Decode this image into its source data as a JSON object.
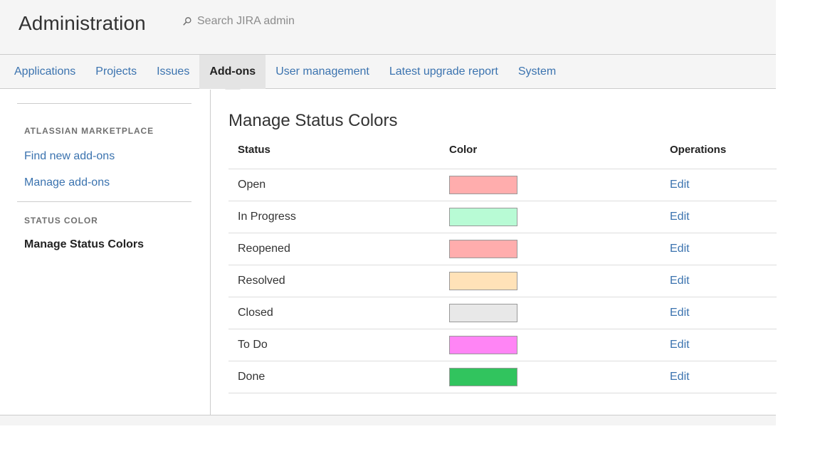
{
  "header": {
    "title": "Administration",
    "search_placeholder": "Search JIRA admin",
    "search_icon": "search-icon"
  },
  "tabs": [
    {
      "label": "Applications",
      "active": false
    },
    {
      "label": "Projects",
      "active": false
    },
    {
      "label": "Issues",
      "active": false
    },
    {
      "label": "Add-ons",
      "active": true
    },
    {
      "label": "User management",
      "active": false
    },
    {
      "label": "Latest upgrade report",
      "active": false
    },
    {
      "label": "System",
      "active": false
    }
  ],
  "sidebar": {
    "sections": [
      {
        "heading": "ATLASSIAN MARKETPLACE",
        "items": [
          {
            "label": "Find new add-ons",
            "current": false
          },
          {
            "label": "Manage add-ons",
            "current": false
          }
        ]
      },
      {
        "heading": "STATUS COLOR",
        "items": [
          {
            "label": "Manage Status Colors",
            "current": true
          }
        ]
      }
    ]
  },
  "main": {
    "page_title": "Manage Status Colors",
    "table": {
      "columns": [
        "Status",
        "Color",
        "Operations"
      ],
      "rows": [
        {
          "status": "Open",
          "color": "#ffadad",
          "edit_label": "Edit"
        },
        {
          "status": "In Progress",
          "color": "#b8fbd5",
          "edit_label": "Edit"
        },
        {
          "status": "Reopened",
          "color": "#ffadad",
          "edit_label": "Edit"
        },
        {
          "status": "Resolved",
          "color": "#ffe2b8",
          "edit_label": "Edit"
        },
        {
          "status": "Closed",
          "color": "#e8e8e8",
          "edit_label": "Edit"
        },
        {
          "status": "To Do",
          "color": "#ff85f5",
          "edit_label": "Edit"
        },
        {
          "status": "Done",
          "color": "#31c45e",
          "edit_label": "Edit"
        }
      ]
    }
  },
  "colors": {
    "link": "#3b73af",
    "text": "#333333",
    "header_bg": "#f5f5f5",
    "active_tab_bg": "#e4e4e4",
    "border": "#cccccc"
  }
}
